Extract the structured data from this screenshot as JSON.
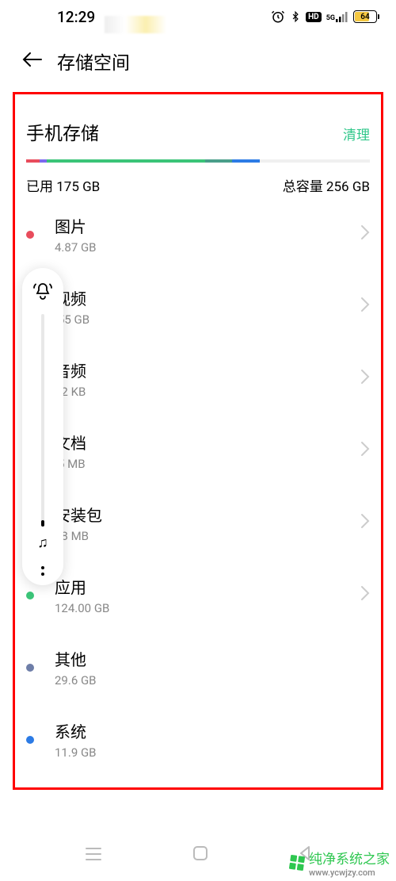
{
  "status": {
    "time": "12:29",
    "battery": "64"
  },
  "header": {
    "title": "存储空间"
  },
  "storage": {
    "section_title": "手机存储",
    "clean_label": "清理",
    "used_label": "已用 175 GB",
    "total_label": "总容量 256 GB"
  },
  "categories": [
    {
      "name": "图片",
      "size": "4.87 GB",
      "dot": "#e84c5c",
      "chevron": true
    },
    {
      "name": "视频",
      "size": ".55 GB",
      "dot": "#7b68ee",
      "chevron": true
    },
    {
      "name": "音频",
      "size": "62 KB",
      "dot": "",
      "chevron": true
    },
    {
      "name": "文档",
      "size": ".5 MB",
      "dot": "",
      "chevron": true
    },
    {
      "name": "安装包",
      "size": "08 MB",
      "dot": "",
      "chevron": true
    },
    {
      "name": "应用",
      "size": "124.00  GB",
      "dot": "#3bc478",
      "chevron": true
    },
    {
      "name": "其他",
      "size": "29.6 GB",
      "dot": "#6e7ea8",
      "chevron": false
    },
    {
      "name": "系统",
      "size": "11.9 GB",
      "dot": "#2c7be5",
      "chevron": false
    }
  ],
  "watermark": {
    "text": "纯净系统之家",
    "url": "www.ycwjzy.com"
  }
}
